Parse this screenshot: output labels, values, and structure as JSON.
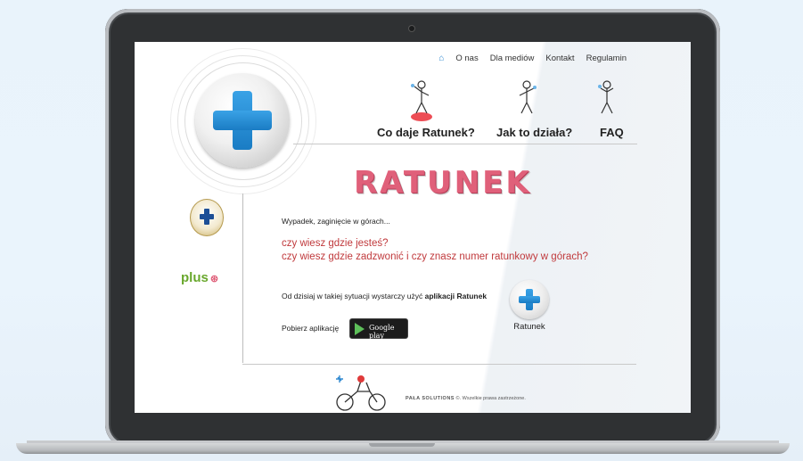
{
  "nav": {
    "items": [
      "O nas",
      "Dla mediów",
      "Kontakt",
      "Regulamin"
    ],
    "home_icon": "home-icon"
  },
  "header": {
    "links": [
      "Co daje Ratunek?",
      "Jak to działa?",
      "FAQ"
    ]
  },
  "main": {
    "title": "RATUNEK",
    "intro": "Wypadek, zaginięcie w górach...",
    "question1": "czy wiesz gdzie jesteś?",
    "question2": "czy wiesz gdzie zadzwonić i czy znasz numer ratunkowy w górach?",
    "usage_prefix": "Od dzisiaj w takiej sytuacji wystarczy użyć ",
    "usage_bold": "aplikacji Ratunek",
    "download_label": "Pobierz aplikację",
    "store_button": "Google play",
    "app_name": "Ratunek"
  },
  "sidebar": {
    "partner": "plus"
  },
  "footer": {
    "brand": "PAŁA SOLUTIONS",
    "text": "©. Wszelkie prawa zastrzeżone."
  },
  "colors": {
    "accent_red": "#c0393c",
    "title_pink": "#e0607a",
    "cross_blue": "#1a7cc4",
    "plus_green": "#6aa82e"
  }
}
